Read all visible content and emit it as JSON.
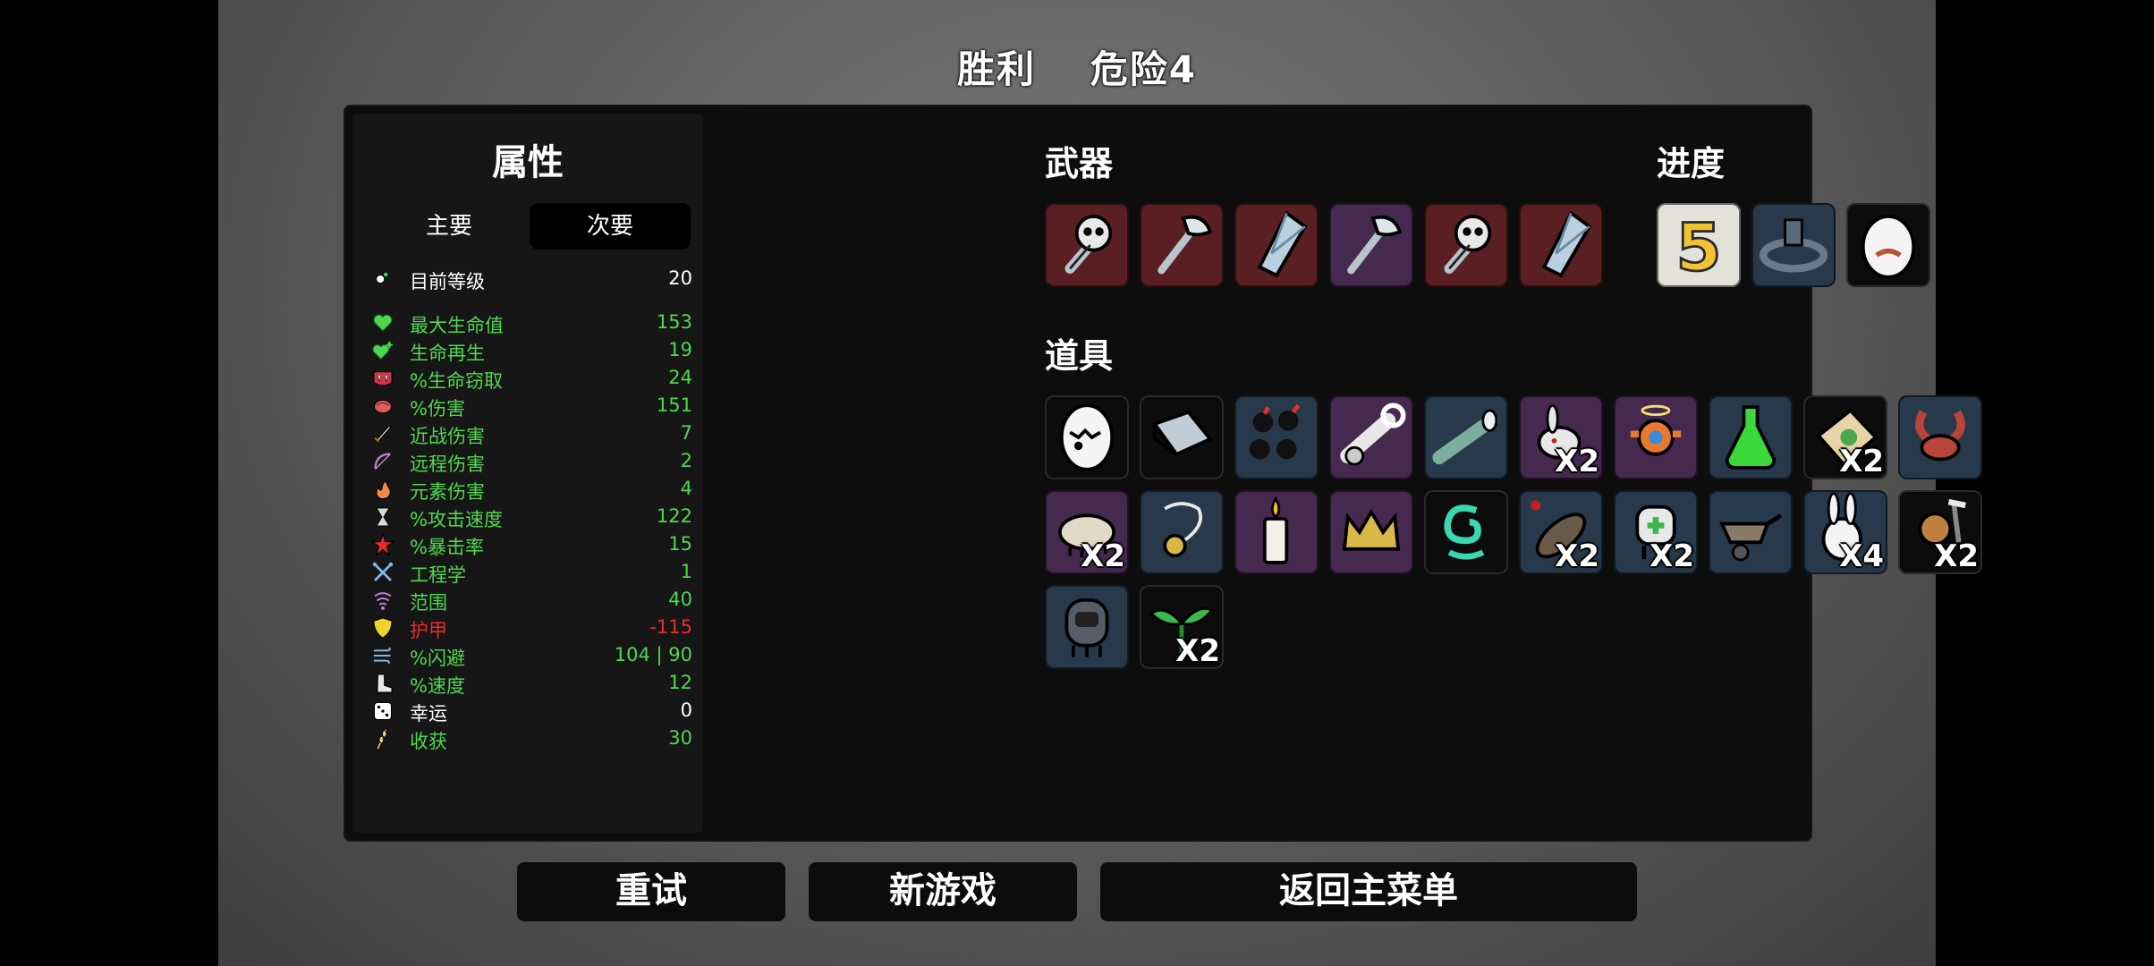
{
  "header": {
    "result": "胜利",
    "danger": "危险4"
  },
  "stats": {
    "title": "属性",
    "tabs": [
      "主要",
      "次要"
    ],
    "level": {
      "name": "目前等级",
      "value": "20",
      "icon": "level-icon",
      "tone": "w"
    },
    "rows": [
      {
        "name": "最大生命值",
        "value": "153",
        "icon": "heart-icon",
        "tone": "g"
      },
      {
        "name": "生命再生",
        "value": "19",
        "icon": "regen-heart-icon",
        "tone": "g"
      },
      {
        "name": "%生命窃取",
        "value": "24",
        "icon": "vampire-fangs-icon",
        "tone": "g"
      },
      {
        "name": "%伤害",
        "value": "151",
        "icon": "muscle-icon",
        "tone": "g"
      },
      {
        "name": "近战伤害",
        "value": "7",
        "icon": "sword-icon",
        "tone": "g"
      },
      {
        "name": "远程伤害",
        "value": "2",
        "icon": "bow-icon",
        "tone": "g"
      },
      {
        "name": "元素伤害",
        "value": "4",
        "icon": "flame-icon",
        "tone": "g"
      },
      {
        "name": "%攻击速度",
        "value": "122",
        "icon": "hourglass-icon",
        "tone": "g"
      },
      {
        "name": "%暴击率",
        "value": "15",
        "icon": "crit-burst-icon",
        "tone": "g"
      },
      {
        "name": "工程学",
        "value": "1",
        "icon": "wrench-icon",
        "tone": "g"
      },
      {
        "name": "范围",
        "value": "40",
        "icon": "range-wave-icon",
        "tone": "g"
      },
      {
        "name": "护甲",
        "value": "-115",
        "icon": "shield-icon",
        "tone": "r"
      },
      {
        "name": "%闪避",
        "value": "104 | 90",
        "icon": "dodge-wind-icon",
        "tone": "g"
      },
      {
        "name": "%速度",
        "value": "12",
        "icon": "boot-icon",
        "tone": "g"
      },
      {
        "name": "幸运",
        "value": "0",
        "icon": "dice-icon",
        "tone": "w"
      },
      {
        "name": "收获",
        "value": "30",
        "icon": "wheat-icon",
        "tone": "g"
      }
    ]
  },
  "sections": {
    "weapons": "武器",
    "progress": "进度",
    "items": "道具"
  },
  "weapons": [
    {
      "icon": "skull-mace-icon",
      "tier": "t-red"
    },
    {
      "icon": "axe-icon",
      "tier": "t-red"
    },
    {
      "icon": "crystal-shard-icon",
      "tier": "t-red"
    },
    {
      "icon": "axe-icon",
      "tier": "t-purple"
    },
    {
      "icon": "skull-mace-icon",
      "tier": "t-red"
    },
    {
      "icon": "crystal-shard-icon",
      "tier": "t-red"
    }
  ],
  "progress": [
    {
      "icon": "danger-five-icon",
      "tier": "t-light",
      "label": "5"
    },
    {
      "icon": "stone-crown-icon",
      "tier": "t-blue"
    },
    {
      "icon": "mustache-egg-icon",
      "tier": "t-black"
    }
  ],
  "items": [
    {
      "icon": "cracked-egg-icon",
      "tier": "t-black",
      "qty": ""
    },
    {
      "icon": "book-icon",
      "tier": "t-black",
      "qty": ""
    },
    {
      "icon": "bomb-cluster-icon",
      "tier": "t-blue",
      "qty": ""
    },
    {
      "icon": "cannon-icon",
      "tier": "t-purple",
      "qty": ""
    },
    {
      "icon": "spyglass-icon",
      "tier": "t-blue",
      "qty": ""
    },
    {
      "icon": "rabbit-head-icon",
      "tier": "t-purple",
      "qty": "X2"
    },
    {
      "icon": "angel-drone-icon",
      "tier": "t-purple",
      "qty": ""
    },
    {
      "icon": "green-potion-icon",
      "tier": "t-blue",
      "qty": ""
    },
    {
      "icon": "treasure-map-icon",
      "tier": "t-black",
      "qty": "X2"
    },
    {
      "icon": "crab-claws-icon",
      "tier": "t-blue",
      "qty": ""
    },
    {
      "icon": "tardigrade-icon",
      "tier": "t-purple",
      "qty": "X2"
    },
    {
      "icon": "pendant-icon",
      "tier": "t-blue",
      "qty": ""
    },
    {
      "icon": "candle-icon",
      "tier": "t-purple",
      "qty": ""
    },
    {
      "icon": "crown-icon",
      "tier": "t-purple",
      "qty": ""
    },
    {
      "icon": "spiral-ghost-icon",
      "tier": "t-black",
      "qty": ""
    },
    {
      "icon": "larva-icon",
      "tier": "t-blue",
      "qty": "X2"
    },
    {
      "icon": "medic-robot-icon",
      "tier": "t-blue",
      "qty": "X2"
    },
    {
      "icon": "wheelbarrow-icon",
      "tier": "t-blue",
      "qty": ""
    },
    {
      "icon": "white-rabbit-icon",
      "tier": "t-blue",
      "qty": "X4"
    },
    {
      "icon": "lumberjack-icon",
      "tier": "t-black",
      "qty": "X2"
    },
    {
      "icon": "diving-helmet-icon",
      "tier": "t-blue",
      "qty": ""
    },
    {
      "icon": "sprout-icon",
      "tier": "t-black",
      "qty": "X2"
    }
  ],
  "buttons": {
    "retry": "重试",
    "new_game": "新游戏",
    "main_menu": "返回主菜单"
  }
}
